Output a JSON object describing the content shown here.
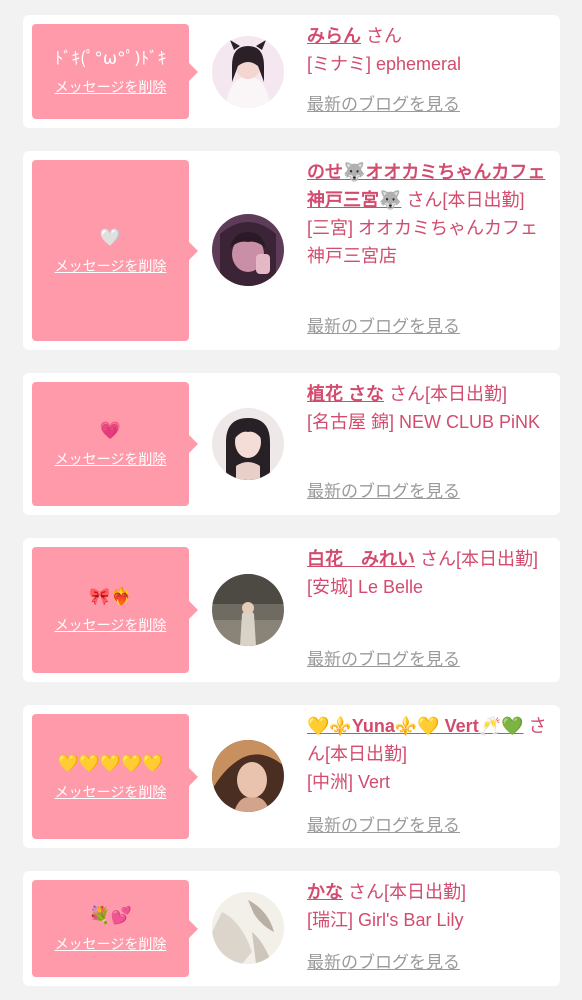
{
  "theme": {
    "accent": "#d24c6e",
    "bubble": "#ff9aaa",
    "link_muted": "#9a9a9a",
    "background": "#f2f2f2"
  },
  "cards": [
    {
      "message": "ﾄﾞｷ(ﾟ°ω°ﾟ)ﾄﾞｷ",
      "delete_label": "メッセージを削除",
      "name": "みらん",
      "suffix": "さん",
      "shop": "[ミナミ] ephemeral",
      "blog_link": "最新のブログを見る",
      "avatar_colors": [
        "#f4e7ef",
        "#2b2026"
      ]
    },
    {
      "message": "🤍",
      "delete_label": "メッセージを削除",
      "name": "のせ🐺オオカミちゃんカフェ神戸三宮🐺",
      "suffix": "さん[本日出勤]",
      "shop": "[三宮] オオカミちゃんカフェ神戸三宮店",
      "blog_link": "最新のブログを見る",
      "avatar_colors": [
        "#5e3b59",
        "#c98fa6"
      ]
    },
    {
      "message": "💗",
      "delete_label": "メッセージを削除",
      "name": "植花 さな",
      "suffix": "さん[本日出勤]",
      "shop": "[名古屋 錦] NEW CLUB PiNK",
      "blog_link": "最新のブログを見る",
      "avatar_colors": [
        "#efe8e8",
        "#272024"
      ]
    },
    {
      "message": "🎀❤️‍🔥",
      "delete_label": "メッセージを削除",
      "name": "白花　みれい",
      "suffix": "さん[本日出勤]",
      "shop": "[安城] Le Belle",
      "blog_link": "最新のブログを見る",
      "avatar_colors": [
        "#6f6a62",
        "#d9d2c7"
      ]
    },
    {
      "message": "💛💛💛💛💛",
      "delete_label": "メッセージを削除",
      "name": "💛⚜️Yuna⚜️💛 Vert🥂💚",
      "suffix": "さん[本日出勤]",
      "shop": "[中洲] Vert",
      "blog_link": "最新のブログを見る",
      "avatar_colors": [
        "#4a2e22",
        "#e9c3ad"
      ]
    },
    {
      "message": "💐💕",
      "delete_label": "メッセージを削除",
      "name": "かな",
      "suffix": "さん[本日出勤]",
      "shop": "[瑞江] Girl's Bar Lily",
      "blog_link": "最新のブログを見る",
      "avatar_colors": [
        "#f3efe9",
        "#b8afa5"
      ]
    }
  ]
}
